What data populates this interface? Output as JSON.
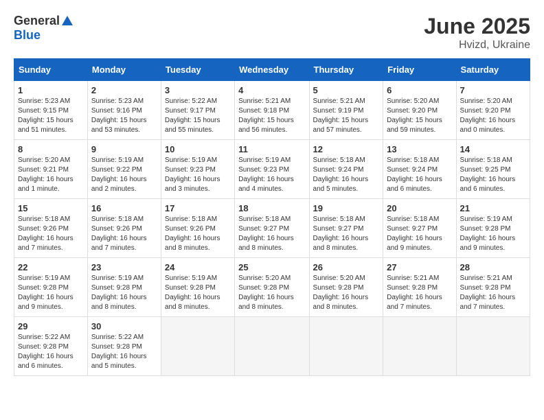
{
  "logo": {
    "general": "General",
    "blue": "Blue"
  },
  "title": "June 2025",
  "subtitle": "Hvizd, Ukraine",
  "headers": [
    "Sunday",
    "Monday",
    "Tuesday",
    "Wednesday",
    "Thursday",
    "Friday",
    "Saturday"
  ],
  "weeks": [
    [
      {
        "day": "1",
        "info": "Sunrise: 5:23 AM\nSunset: 9:15 PM\nDaylight: 15 hours\nand 51 minutes."
      },
      {
        "day": "2",
        "info": "Sunrise: 5:23 AM\nSunset: 9:16 PM\nDaylight: 15 hours\nand 53 minutes."
      },
      {
        "day": "3",
        "info": "Sunrise: 5:22 AM\nSunset: 9:17 PM\nDaylight: 15 hours\nand 55 minutes."
      },
      {
        "day": "4",
        "info": "Sunrise: 5:21 AM\nSunset: 9:18 PM\nDaylight: 15 hours\nand 56 minutes."
      },
      {
        "day": "5",
        "info": "Sunrise: 5:21 AM\nSunset: 9:19 PM\nDaylight: 15 hours\nand 57 minutes."
      },
      {
        "day": "6",
        "info": "Sunrise: 5:20 AM\nSunset: 9:20 PM\nDaylight: 15 hours\nand 59 minutes."
      },
      {
        "day": "7",
        "info": "Sunrise: 5:20 AM\nSunset: 9:20 PM\nDaylight: 16 hours\nand 0 minutes."
      }
    ],
    [
      {
        "day": "8",
        "info": "Sunrise: 5:20 AM\nSunset: 9:21 PM\nDaylight: 16 hours\nand 1 minute."
      },
      {
        "day": "9",
        "info": "Sunrise: 5:19 AM\nSunset: 9:22 PM\nDaylight: 16 hours\nand 2 minutes."
      },
      {
        "day": "10",
        "info": "Sunrise: 5:19 AM\nSunset: 9:23 PM\nDaylight: 16 hours\nand 3 minutes."
      },
      {
        "day": "11",
        "info": "Sunrise: 5:19 AM\nSunset: 9:23 PM\nDaylight: 16 hours\nand 4 minutes."
      },
      {
        "day": "12",
        "info": "Sunrise: 5:18 AM\nSunset: 9:24 PM\nDaylight: 16 hours\nand 5 minutes."
      },
      {
        "day": "13",
        "info": "Sunrise: 5:18 AM\nSunset: 9:24 PM\nDaylight: 16 hours\nand 6 minutes."
      },
      {
        "day": "14",
        "info": "Sunrise: 5:18 AM\nSunset: 9:25 PM\nDaylight: 16 hours\nand 6 minutes."
      }
    ],
    [
      {
        "day": "15",
        "info": "Sunrise: 5:18 AM\nSunset: 9:26 PM\nDaylight: 16 hours\nand 7 minutes."
      },
      {
        "day": "16",
        "info": "Sunrise: 5:18 AM\nSunset: 9:26 PM\nDaylight: 16 hours\nand 7 minutes."
      },
      {
        "day": "17",
        "info": "Sunrise: 5:18 AM\nSunset: 9:26 PM\nDaylight: 16 hours\nand 8 minutes."
      },
      {
        "day": "18",
        "info": "Sunrise: 5:18 AM\nSunset: 9:27 PM\nDaylight: 16 hours\nand 8 minutes."
      },
      {
        "day": "19",
        "info": "Sunrise: 5:18 AM\nSunset: 9:27 PM\nDaylight: 16 hours\nand 8 minutes."
      },
      {
        "day": "20",
        "info": "Sunrise: 5:18 AM\nSunset: 9:27 PM\nDaylight: 16 hours\nand 9 minutes."
      },
      {
        "day": "21",
        "info": "Sunrise: 5:19 AM\nSunset: 9:28 PM\nDaylight: 16 hours\nand 9 minutes."
      }
    ],
    [
      {
        "day": "22",
        "info": "Sunrise: 5:19 AM\nSunset: 9:28 PM\nDaylight: 16 hours\nand 9 minutes."
      },
      {
        "day": "23",
        "info": "Sunrise: 5:19 AM\nSunset: 9:28 PM\nDaylight: 16 hours\nand 8 minutes."
      },
      {
        "day": "24",
        "info": "Sunrise: 5:19 AM\nSunset: 9:28 PM\nDaylight: 16 hours\nand 8 minutes."
      },
      {
        "day": "25",
        "info": "Sunrise: 5:20 AM\nSunset: 9:28 PM\nDaylight: 16 hours\nand 8 minutes."
      },
      {
        "day": "26",
        "info": "Sunrise: 5:20 AM\nSunset: 9:28 PM\nDaylight: 16 hours\nand 8 minutes."
      },
      {
        "day": "27",
        "info": "Sunrise: 5:21 AM\nSunset: 9:28 PM\nDaylight: 16 hours\nand 7 minutes."
      },
      {
        "day": "28",
        "info": "Sunrise: 5:21 AM\nSunset: 9:28 PM\nDaylight: 16 hours\nand 7 minutes."
      }
    ],
    [
      {
        "day": "29",
        "info": "Sunrise: 5:22 AM\nSunset: 9:28 PM\nDaylight: 16 hours\nand 6 minutes."
      },
      {
        "day": "30",
        "info": "Sunrise: 5:22 AM\nSunset: 9:28 PM\nDaylight: 16 hours\nand 5 minutes."
      },
      {
        "day": "",
        "info": ""
      },
      {
        "day": "",
        "info": ""
      },
      {
        "day": "",
        "info": ""
      },
      {
        "day": "",
        "info": ""
      },
      {
        "day": "",
        "info": ""
      }
    ]
  ]
}
